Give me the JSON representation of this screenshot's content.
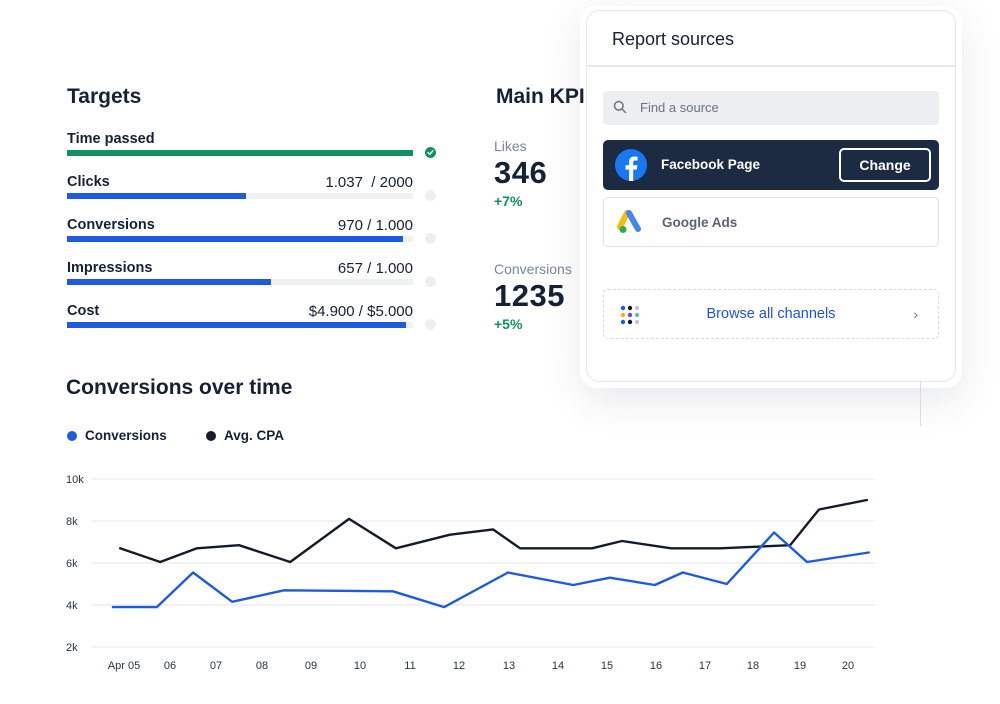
{
  "targets": {
    "title": "Targets",
    "rows": [
      {
        "label": "Time passed",
        "value": "",
        "progress": 1.0,
        "complete": true
      },
      {
        "label": "Clicks",
        "value": "1.037  / 2000",
        "progress": 0.5185,
        "complete": false
      },
      {
        "label": "Conversions",
        "value": "970 / 1.000",
        "progress": 0.97,
        "complete": false
      },
      {
        "label": "Impressions",
        "value": "657 / 1.000",
        "progress": 0.59,
        "complete": false
      },
      {
        "label": "Cost",
        "value": "$4.900 / $5.000",
        "progress": 0.98,
        "complete": false
      }
    ]
  },
  "kpi": {
    "title": "Main KPI",
    "items": [
      {
        "label": "Likes",
        "value": "346",
        "delta": "+7%"
      },
      {
        "label": "Conversions",
        "value": "1235",
        "delta": "+5%"
      }
    ]
  },
  "chart_section": {
    "title": "Conversions over time",
    "legend": [
      {
        "label": "Conversions",
        "color": "#1e5be0"
      },
      {
        "label": "Avg. CPA",
        "color": "#151c28"
      }
    ]
  },
  "chart_data": {
    "type": "line",
    "title": "Conversions over time",
    "xlabel": "",
    "ylabel": "",
    "x_tick_labels": [
      "Apr 05",
      "06",
      "07",
      "08",
      "09",
      "10",
      "11",
      "12",
      "13",
      "14",
      "15",
      "16",
      "17",
      "18",
      "19",
      "20"
    ],
    "y_tick_labels": [
      "10k",
      "8k",
      "6k",
      "4k",
      "2k"
    ],
    "y_ticks": [
      10000,
      8000,
      6000,
      4000,
      2000
    ],
    "ylim": [
      2000,
      10000
    ],
    "xlim": [
      -0.2,
      15.4
    ],
    "grid": true,
    "legend_position": "top-left",
    "series": [
      {
        "name": "Conversions",
        "color": "#1e5be0",
        "points": [
          [
            -0.23,
            3900
          ],
          [
            0.68,
            3900
          ],
          [
            1.43,
            5550
          ],
          [
            2.24,
            4150
          ],
          [
            3.31,
            4700
          ],
          [
            5.57,
            4650
          ],
          [
            6.63,
            3900
          ],
          [
            7.95,
            5550
          ],
          [
            9.3,
            4950
          ],
          [
            10.06,
            5300
          ],
          [
            10.99,
            4950
          ],
          [
            11.57,
            5550
          ],
          [
            12.48,
            5000
          ],
          [
            13.46,
            7450
          ],
          [
            14.14,
            6050
          ],
          [
            15.42,
            6500
          ]
        ]
      },
      {
        "name": "Avg. CPA",
        "color": "#151c28",
        "points": [
          [
            -0.08,
            6700
          ],
          [
            0.75,
            6050
          ],
          [
            1.51,
            6700
          ],
          [
            2.38,
            6850
          ],
          [
            3.44,
            6050
          ],
          [
            4.66,
            8100
          ],
          [
            5.63,
            6700
          ],
          [
            6.75,
            7350
          ],
          [
            7.64,
            7600
          ],
          [
            8.2,
            6700
          ],
          [
            9.69,
            6700
          ],
          [
            10.31,
            7050
          ],
          [
            11.33,
            6700
          ],
          [
            12.34,
            6700
          ],
          [
            13.79,
            6850
          ],
          [
            14.39,
            8550
          ],
          [
            15.38,
            9000
          ]
        ]
      }
    ]
  },
  "report_sources": {
    "title": "Report sources",
    "search_placeholder": "Find a source",
    "sources": [
      {
        "name": "Facebook Page",
        "icon": "facebook-icon",
        "selected": true,
        "action": "Change"
      },
      {
        "name": "Google Ads",
        "icon": "google-ads-icon",
        "selected": false
      }
    ],
    "browse_label": "Browse all channels",
    "browse_chevron": "›"
  }
}
